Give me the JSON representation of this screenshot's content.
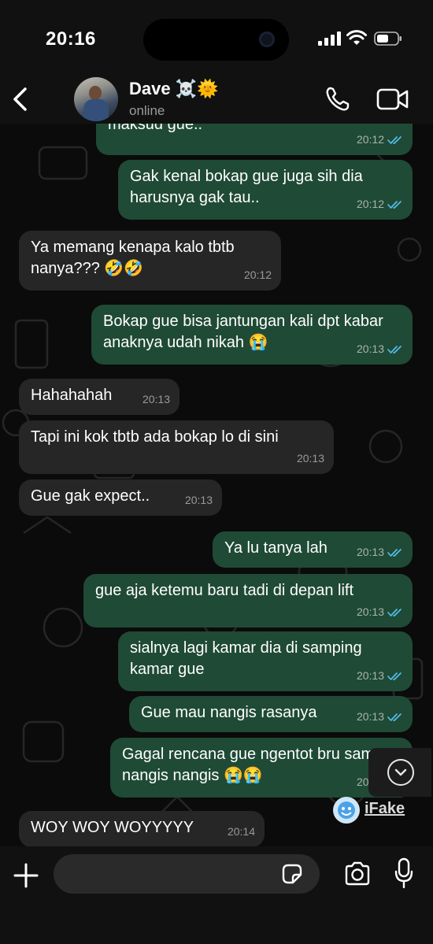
{
  "status_bar": {
    "time": "20:16"
  },
  "header": {
    "name": "Dave ☠️🌞",
    "status": "online"
  },
  "messages": [
    {
      "dir": "out",
      "text": "maksud gue..",
      "time": "20:12",
      "read": true
    },
    {
      "dir": "out",
      "text": "Gak kenal bokap gue juga sih dia harusnya gak tau..",
      "time": "20:12",
      "read": true
    },
    {
      "dir": "in",
      "text": "Ya memang kenapa kalo tbtb nanya??? 🤣🤣",
      "time": "20:12"
    },
    {
      "dir": "out",
      "text": "Bokap gue bisa jantungan kali dpt kabar anaknya udah nikah 😭",
      "time": "20:13",
      "read": true
    },
    {
      "dir": "in",
      "text": "Hahahahah",
      "time": "20:13"
    },
    {
      "dir": "in",
      "text": "Tapi ini kok tbtb ada bokap lo di sini",
      "time": "20:13"
    },
    {
      "dir": "in",
      "text": "Gue gak expect..",
      "time": "20:13"
    },
    {
      "dir": "out",
      "text": "Ya lu tanya lah",
      "time": "20:13",
      "read": true
    },
    {
      "dir": "out",
      "text": "gue aja ketemu baru tadi di depan lift",
      "time": "20:13",
      "read": true
    },
    {
      "dir": "out",
      "text": "sialnya lagi kamar dia di samping kamar gue",
      "time": "20:13",
      "read": true
    },
    {
      "dir": "out",
      "text": "Gue mau nangis rasanya",
      "time": "20:13",
      "read": true
    },
    {
      "dir": "out",
      "text": "Gagal rencana gue ngentot bru sampe nangis nangis 😭😭",
      "time": "20:13",
      "read": true
    },
    {
      "dir": "in",
      "text": "WOY WOY WOYYYYY",
      "time": "20:14"
    }
  ],
  "watermark": {
    "text": "iFake"
  },
  "colors": {
    "outgoing_bubble": "#1f4a36",
    "incoming_bubble": "#262626",
    "read_tick": "#53bdeb",
    "background": "#0b0b0b"
  },
  "icons": [
    "back-chevron-icon",
    "phone-icon",
    "video-call-icon",
    "plus-icon",
    "sticker-icon",
    "camera-icon",
    "microphone-icon",
    "scroll-down-icon"
  ]
}
